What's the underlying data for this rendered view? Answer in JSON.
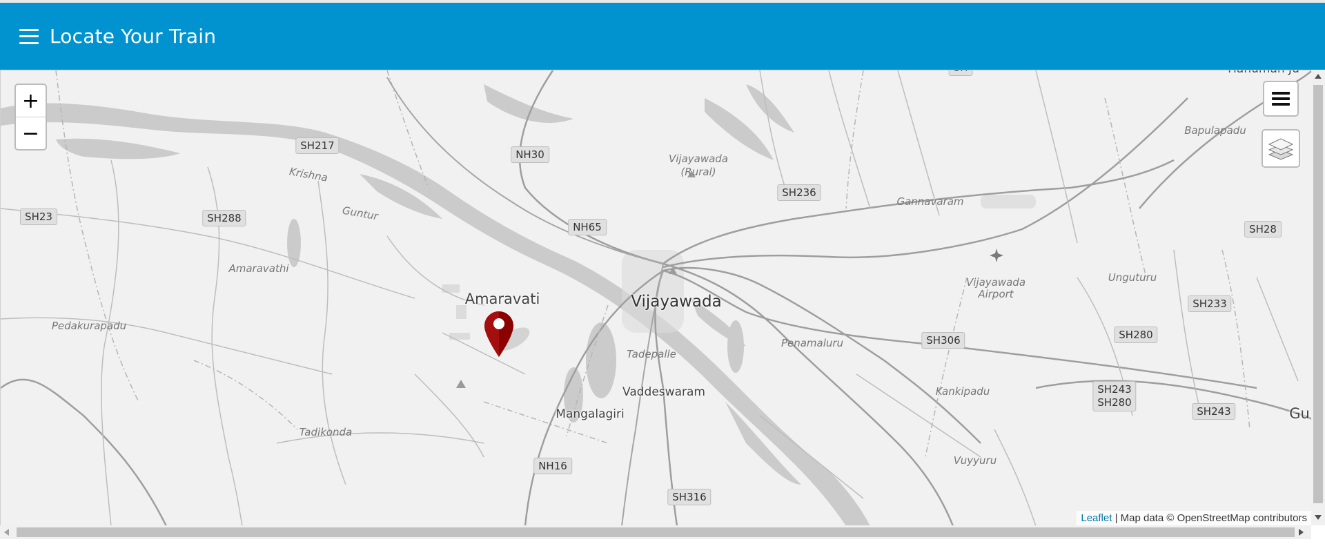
{
  "app": {
    "title": "Locate Your Train",
    "menu_icon": "hamburger-menu-icon"
  },
  "map": {
    "zoom_in_label": "+",
    "zoom_out_label": "−",
    "marker": {
      "label": "Amaravati",
      "icon": "map-pin-icon",
      "color": "#8b0000"
    },
    "places": {
      "vijayawada": "Vijayawada",
      "amaravati_town": "Amaravati",
      "vaddeswaram": "Vaddeswaram",
      "mangalagiri": "Mangalagiri",
      "amaravathi": "Amaravathi",
      "pedakurapadu": "Pedakurapadu",
      "tadikonda": "Tadikonda",
      "tadepalle": "Tadepalle",
      "penamaluru": "Penamaluru",
      "kankipadu": "Kankipadu",
      "vuyyuru": "Vuyyuru",
      "gannavaram": "Gannavaram",
      "unguturu": "Unguturu",
      "bapulapadu": "Bapulapadu",
      "vijayawada_rural_1": "Vijayawada",
      "vijayawada_rural_2": "(Rural)",
      "airport_1": "Vijayawada",
      "airport_2": "Airport",
      "krishna": "Krishna",
      "guntur": "Guntur",
      "hanuman": "Hanuman Ju",
      "gu": "Gu"
    },
    "roads": {
      "sh217": "SH217",
      "nh30": "NH30",
      "sh23": "SH23",
      "sh288": "SH288",
      "nh65": "NH65",
      "sh236": "SH236",
      "sh28": "SH28",
      "sh233": "SH233",
      "sh280": "SH280",
      "sh306": "SH306",
      "sh243_280_a": "SH243",
      "sh243_280_b": "SH280",
      "sh243": "SH243",
      "nh16": "NH16",
      "sh316": "SH316",
      "sh_top": "SH"
    },
    "controls": {
      "layers_menu_icon": "list-menu-icon",
      "layers_icon": "layers-icon"
    },
    "attribution": {
      "link": "Leaflet",
      "text": " | Map data © OpenStreetMap contributors"
    }
  },
  "colors": {
    "header": "#0093d0",
    "marker": "#8b0000",
    "map_bg": "#f1f1f1",
    "water": "#cbcbcb"
  }
}
